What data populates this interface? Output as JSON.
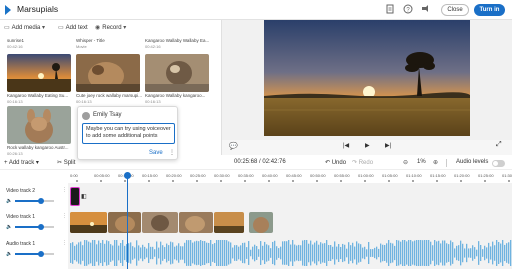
{
  "header": {
    "title": "Marsupials",
    "close_label": "Close",
    "turn_in_label": "Turn in"
  },
  "toolbar": {
    "add_media_label": "Add media",
    "add_text_label": "Add text",
    "record_label": "Record"
  },
  "media": [
    {
      "title": "sunrise1",
      "duration": "00:42:16"
    },
    {
      "title": "Whisper - Title",
      "duration": "Movie"
    },
    {
      "title": "Kangaroo Wallaby Wallaby Ea...",
      "duration": "00:42:16"
    },
    {
      "title": "Kangaroo Wallaby Eating Su...",
      "duration": "00:16:13"
    },
    {
      "title": "Cute joey rock wallaby marsupi...",
      "duration": "00:16:13"
    },
    {
      "title": "Kangaroo Wallaby kangaroo...",
      "duration": "00:16:13"
    },
    {
      "title": "Rock wallaby kangaroo Austr...",
      "duration": "00:26:13"
    }
  ],
  "comment": {
    "author": "Emily Tsay",
    "text": "Maybe you can try using voiceover to add some additional points",
    "save_label": "Save"
  },
  "timeline_toolbar": {
    "add_track_label": "Add track",
    "split_label": "Split",
    "time_current": "00:25:68",
    "time_total": "02:42:76",
    "undo_label": "Undo",
    "redo_label": "Redo",
    "zoom_level": "1%",
    "audio_levels_label": "Audio levels"
  },
  "ruler_ticks": [
    "0:00",
    "00:05:00",
    "00:10:00",
    "00:15:00",
    "00:20:00",
    "00:25:00",
    "00:30:00",
    "00:35:00",
    "00:40:00",
    "00:45:00",
    "00:50:00",
    "00:55:00",
    "01:00:00",
    "01:05:00",
    "01:10:00",
    "01:15:00",
    "01:20:00",
    "01:25:00",
    "01:30:00",
    "01:35:00"
  ],
  "tracks": [
    {
      "name": "Video track 2",
      "volume": 0.5
    },
    {
      "name": "Video track 1",
      "volume": 0.5
    },
    {
      "name": "Audio track 1",
      "volume": 0.5
    }
  ],
  "colors": {
    "accent": "#1a6fc7",
    "audio_wave": "#6fb3e0",
    "clip_border": "#e23dd0"
  }
}
